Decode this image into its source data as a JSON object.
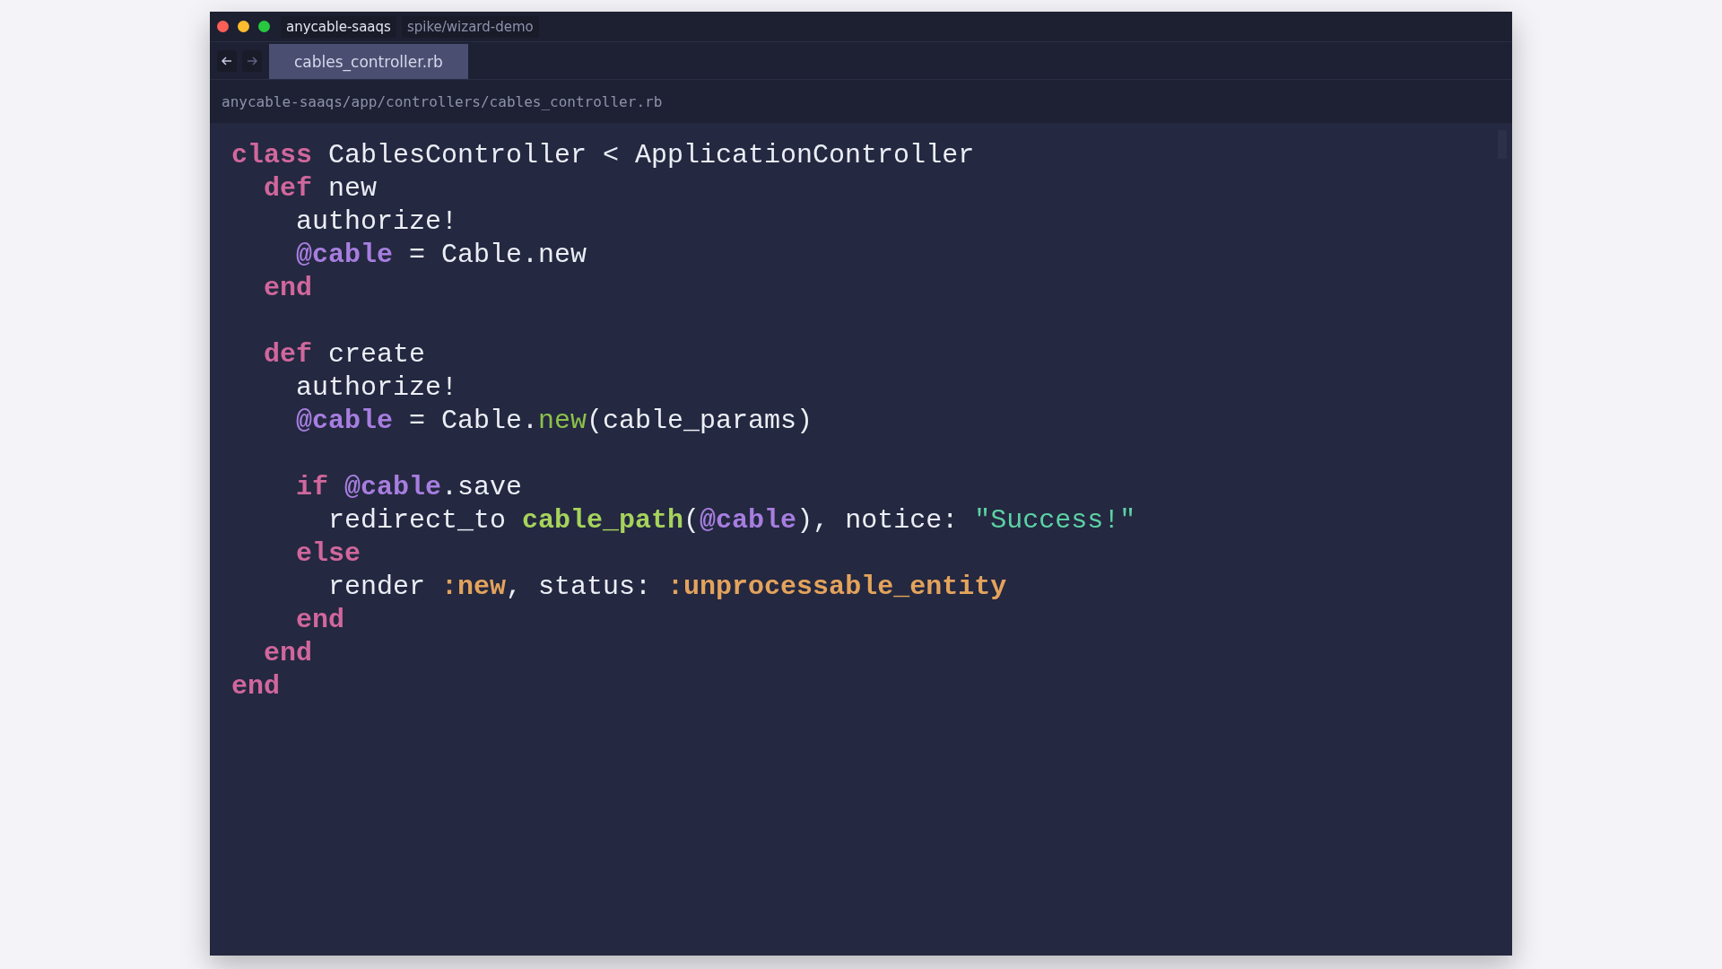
{
  "window": {
    "project": "anycable-saaqs",
    "branch": "spike/wizard-demo"
  },
  "tabs": [
    {
      "label": "cables_controller.rb",
      "selected": true
    }
  ],
  "breadcrumb": "anycable-saaqs/app/controllers/cables_controller.rb",
  "code_blocks": [
    {
      "lines": [
        {
          "tokens": [
            {
              "text": "class",
              "kind": "keyword"
            },
            {
              "text": " CablesController < ApplicationController",
              "kind": "plain"
            }
          ]
        },
        {
          "tokens": [
            {
              "text": "  def",
              "kind": "keyword"
            },
            {
              "text": " new",
              "kind": "plain"
            }
          ]
        },
        {
          "tokens": [
            {
              "text": "    authorize!",
              "kind": "plain"
            }
          ]
        },
        {
          "tokens": [
            {
              "text": "    @cable",
              "kind": "ivar"
            },
            {
              "text": " = Cable.new",
              "kind": "plain"
            }
          ]
        },
        {
          "tokens": [
            {
              "text": "  end",
              "kind": "keyword"
            }
          ]
        }
      ]
    },
    {
      "lines": [
        {
          "tokens": [
            {
              "text": "  def",
              "kind": "keyword"
            },
            {
              "text": " create",
              "kind": "plain"
            }
          ]
        },
        {
          "tokens": [
            {
              "text": "    authorize!",
              "kind": "plain"
            }
          ]
        },
        {
          "tokens": [
            {
              "text": "    @cable",
              "kind": "ivar"
            },
            {
              "text": " = Cable.",
              "kind": "plain"
            },
            {
              "text": "new",
              "kind": "call"
            },
            {
              "text": "(cable_params)",
              "kind": "plain"
            }
          ]
        }
      ]
    },
    {
      "lines": [
        {
          "tokens": [
            {
              "text": "    if ",
              "kind": "keyword"
            },
            {
              "text": "@cable",
              "kind": "ivar"
            },
            {
              "text": ".save",
              "kind": "plain"
            }
          ]
        },
        {
          "tokens": [
            {
              "text": "      redirect_to ",
              "kind": "plain"
            },
            {
              "text": "cable_path",
              "kind": "helper"
            },
            {
              "text": "(",
              "kind": "plain"
            },
            {
              "text": "@cable",
              "kind": "ivar"
            },
            {
              "text": "), notice: ",
              "kind": "plain"
            },
            {
              "text": "\"Success!\"",
              "kind": "string"
            }
          ]
        },
        {
          "tokens": [
            {
              "text": "    else",
              "kind": "keyword"
            }
          ]
        },
        {
          "tokens": [
            {
              "text": "      render ",
              "kind": "plain"
            },
            {
              "text": ":new",
              "kind": "symbol"
            },
            {
              "text": ", status: ",
              "kind": "plain"
            },
            {
              "text": ":unprocessable_entity",
              "kind": "symbol"
            }
          ]
        },
        {
          "tokens": [
            {
              "text": "    end",
              "kind": "keyword"
            }
          ]
        },
        {
          "tokens": [
            {
              "text": "  end",
              "kind": "keyword"
            }
          ]
        },
        {
          "tokens": [
            {
              "text": "end",
              "kind": "keyword"
            }
          ]
        }
      ]
    }
  ]
}
